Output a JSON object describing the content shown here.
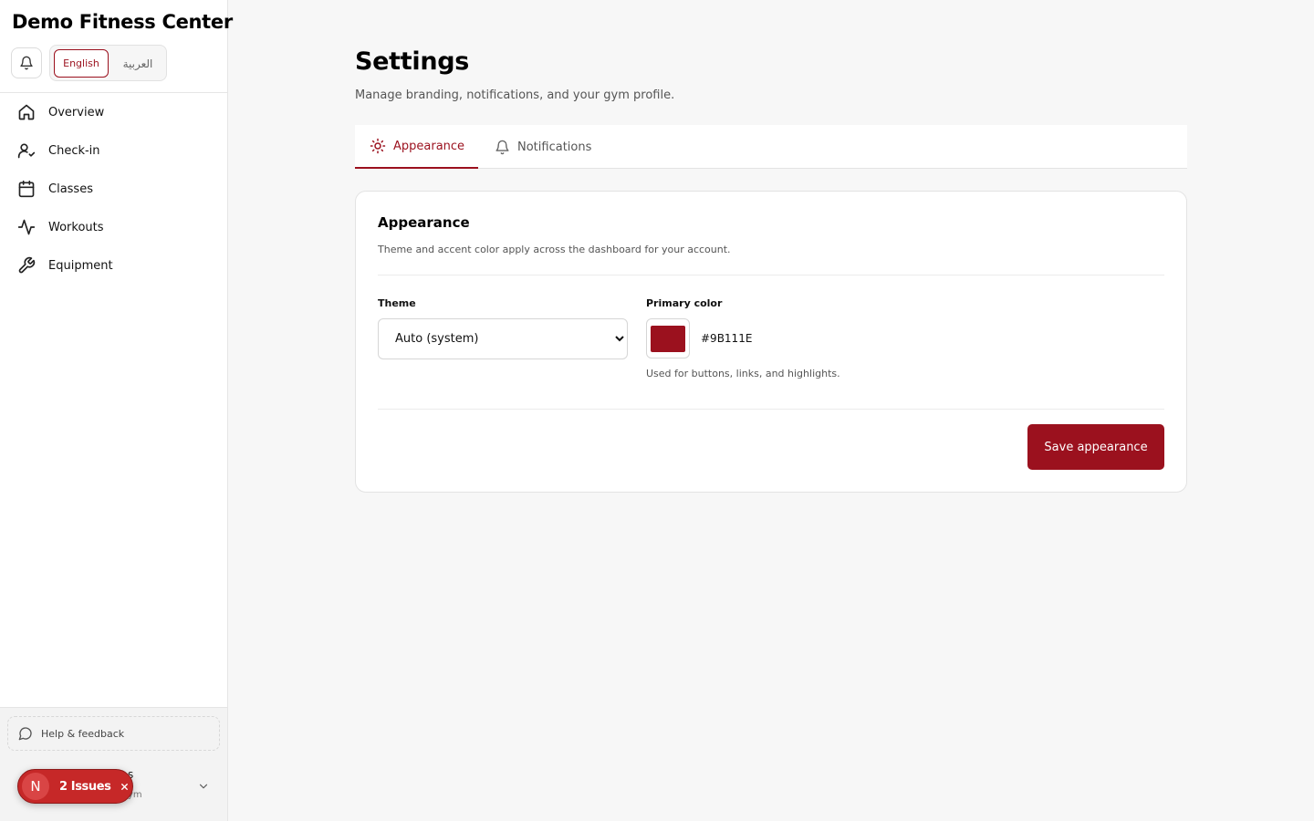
{
  "brand": {
    "name": "Demo Fitness Center"
  },
  "languages": {
    "english": "English",
    "arabic": "العربية"
  },
  "nav": {
    "items": [
      {
        "label": "Overview",
        "icon": "home-icon"
      },
      {
        "label": "Check-in",
        "icon": "user-check-icon"
      },
      {
        "label": "Classes",
        "icon": "calendar-icon"
      },
      {
        "label": "Workouts",
        "icon": "activity-icon"
      },
      {
        "label": "Equipment",
        "icon": "wrench-icon"
      }
    ]
  },
  "sidebar_footer": {
    "help_label": "Help & feedback",
    "user_name": "s",
    "user_sub": "ym"
  },
  "issues_badge": {
    "initial": "N",
    "label": "2 Issues"
  },
  "page": {
    "title": "Settings",
    "subtitle": "Manage branding, notifications, and your gym profile."
  },
  "tabs": {
    "appearance": "Appearance",
    "notifications": "Notifications"
  },
  "appearance_card": {
    "title": "Appearance",
    "description": "Theme and accent color apply across the dashboard for your account.",
    "theme_label": "Theme",
    "theme_value": "Auto (system)",
    "primary_color_label": "Primary color",
    "primary_color_hex": "#9B111E",
    "primary_color_help": "Used for buttons, links, and highlights.",
    "save_label": "Save appearance"
  },
  "colors": {
    "accent": "#9B111E",
    "issues_red": "#C62828"
  }
}
